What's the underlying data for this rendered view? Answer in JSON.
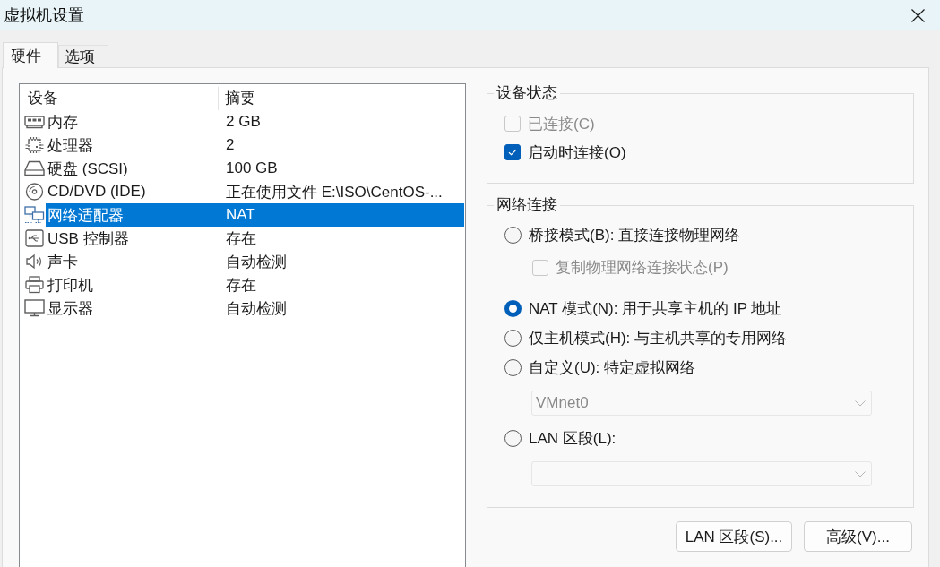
{
  "window": {
    "title": "虚拟机设置"
  },
  "tabs": [
    {
      "label": "硬件",
      "selected": true
    },
    {
      "label": "选项",
      "selected": false
    }
  ],
  "device_table": {
    "columns": [
      "设备",
      "摘要"
    ],
    "rows": [
      {
        "kind": "memory",
        "device": "内存",
        "summary": "2 GB",
        "selected": false
      },
      {
        "kind": "processor",
        "device": "处理器",
        "summary": "2",
        "selected": false
      },
      {
        "kind": "hard_disk",
        "device": "硬盘 (SCSI)",
        "summary": "100 GB",
        "selected": false
      },
      {
        "kind": "cd_dvd",
        "device": "CD/DVD (IDE)",
        "summary": "正在使用文件 E:\\ISO\\CentOS-...",
        "selected": false
      },
      {
        "kind": "network_adapter",
        "device": "网络适配器",
        "summary": "NAT",
        "selected": true
      },
      {
        "kind": "usb",
        "device": "USB 控制器",
        "summary": "存在",
        "selected": false
      },
      {
        "kind": "sound",
        "device": "声卡",
        "summary": "自动检测",
        "selected": false
      },
      {
        "kind": "printer",
        "device": "打印机",
        "summary": "存在",
        "selected": false
      },
      {
        "kind": "display",
        "device": "显示器",
        "summary": "自动检测",
        "selected": false
      }
    ]
  },
  "device_status": {
    "title": "设备状态",
    "options": [
      {
        "label": "已连接(C)",
        "checked": false,
        "disabled": true
      },
      {
        "label": "启动时连接(O)",
        "checked": true,
        "disabled": false
      }
    ]
  },
  "network_connection": {
    "title": "网络连接",
    "items": [
      {
        "kind": "radio",
        "label": "桥接模式(B): 直接连接物理网络",
        "selected": false,
        "disabled": false
      },
      {
        "kind": "checkbox",
        "label": "复制物理网络连接状态(P)",
        "checked": false,
        "disabled": true
      },
      {
        "kind": "radio",
        "label": "NAT 模式(N): 用于共享主机的 IP 地址",
        "selected": true,
        "disabled": false
      },
      {
        "kind": "radio",
        "label": "仅主机模式(H): 与主机共享的专用网络",
        "selected": false,
        "disabled": false
      },
      {
        "kind": "radio",
        "label": "自定义(U): 特定虚拟网络",
        "selected": false,
        "disabled": false
      },
      {
        "kind": "dropdown",
        "value": "VMnet0",
        "disabled": true
      },
      {
        "kind": "radio",
        "label": "LAN 区段(L):",
        "selected": false,
        "disabled": false
      },
      {
        "kind": "dropdown",
        "disabled": true
      }
    ]
  },
  "buttons": [
    "LAN 区段(S)...",
    "高级(V)..."
  ]
}
